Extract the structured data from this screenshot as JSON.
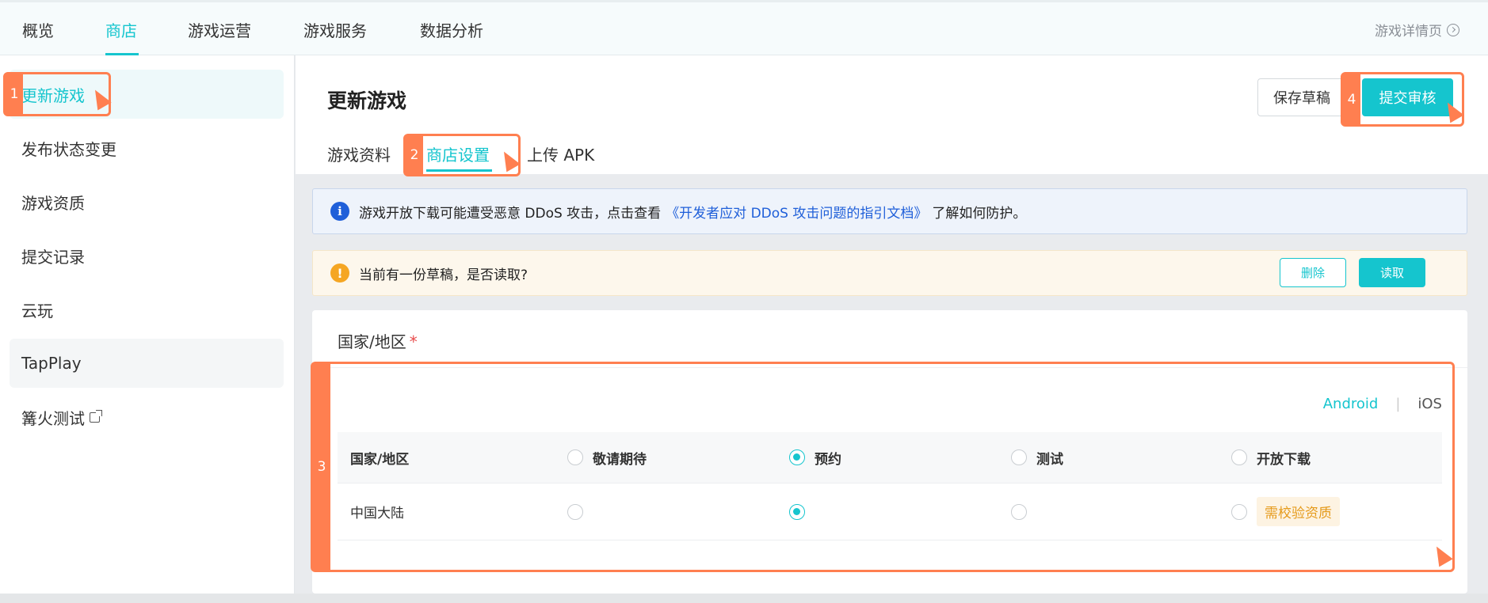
{
  "topnav": {
    "tabs": [
      "概览",
      "商店",
      "游戏运营",
      "游戏服务",
      "数据分析"
    ],
    "active_tab": "商店",
    "detail_link": "游戏详情页"
  },
  "sidebar": {
    "items": [
      {
        "label": "更新游戏",
        "active": true
      },
      {
        "label": "发布状态变更"
      },
      {
        "label": "游戏资质"
      },
      {
        "label": "提交记录"
      },
      {
        "label": "云玩"
      },
      {
        "label": "TapPlay"
      },
      {
        "label": "篝火测试",
        "external": true
      }
    ]
  },
  "header": {
    "title": "更新游戏",
    "save_draft": "保存草稿",
    "submit": "提交审核"
  },
  "subtabs": {
    "items": [
      "游戏资料",
      "商店设置",
      "上传 APK"
    ],
    "active": "商店设置"
  },
  "alerts": {
    "info_prefix": "游戏开放下载可能遭受恶意 DDoS 攻击，点击查看",
    "info_link": "《开发者应对 DDoS 攻击问题的指引文档》",
    "info_suffix": "了解如何防护。",
    "warn_text": "当前有一份草稿，是否读取?",
    "delete": "删除",
    "read": "读取"
  },
  "region": {
    "title": "国家/地区",
    "required_mark": "*",
    "platform_android": "Android",
    "platform_sep": "|",
    "platform_ios": "iOS",
    "columns": [
      "国家/地区",
      "敬请期待",
      "预约",
      "测试",
      "开放下载"
    ],
    "rows": [
      {
        "region": "中国大陆",
        "selected": "预约",
        "download_tag": "需校验资质"
      }
    ]
  },
  "markers": [
    "1",
    "2",
    "3",
    "4"
  ],
  "colors": {
    "accent": "#15c5ce",
    "marker": "#ff7f50",
    "link": "#1f5fd9",
    "warn": "#f5a623"
  }
}
